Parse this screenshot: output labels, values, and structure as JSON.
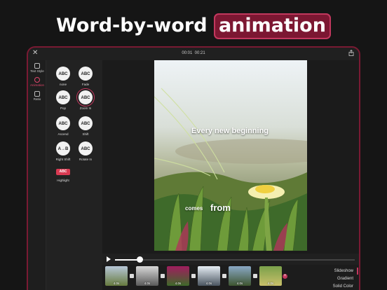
{
  "headline": {
    "plain": "Word-by-word",
    "highlight": "animation"
  },
  "topbar": {
    "time_current": "00:01",
    "time_total": "00:21"
  },
  "rail": [
    {
      "label": "Text Style",
      "icon": "text-style-icon"
    },
    {
      "label": "Animation",
      "icon": "animation-icon"
    },
    {
      "label": "Ratio",
      "icon": "ratio-icon"
    }
  ],
  "effects": [
    {
      "label": "none",
      "glyph": "ABC"
    },
    {
      "label": "Fade",
      "glyph": "ABC"
    },
    {
      "label": "Pop",
      "glyph": "ABC"
    },
    {
      "label": "Zoom In",
      "glyph": "ABC"
    },
    {
      "label": "Ascend",
      "glyph": "ABC"
    },
    {
      "label": "Shift",
      "glyph": "ABC"
    },
    {
      "label": "Right Shift",
      "glyph": "A→B"
    },
    {
      "label": "Rotate In",
      "glyph": "ABC"
    },
    {
      "label": "Highlight",
      "glyph": "ABC"
    }
  ],
  "caption": {
    "line1": "Every new beginning",
    "line2a": "comes",
    "line2b": "from"
  },
  "playback": {
    "progress": 0.1
  },
  "clips": [
    {
      "duration": "4.0s",
      "colors": [
        "#b7c7d8",
        "#667a3e"
      ]
    },
    {
      "duration": "4.0s",
      "colors": [
        "#d8d8d8",
        "#5a5a5a"
      ]
    },
    {
      "duration": "4.0s",
      "colors": [
        "#a01d5e",
        "#3f6a2a"
      ]
    },
    {
      "duration": "4.0s",
      "colors": [
        "#e6eef4",
        "#4a5560"
      ]
    },
    {
      "duration": "4.0s",
      "colors": [
        "#8aa8c6",
        "#3e5530"
      ]
    },
    {
      "duration": "4.0s",
      "colors": [
        "#7aa04a",
        "#c9c06a"
      ]
    }
  ],
  "menu": {
    "slideshow": "Slideshow",
    "gradient": "Gradient",
    "solid": "Solid Color"
  },
  "colors": {
    "accent": "#c2385e",
    "frame": "#7a1a33"
  }
}
